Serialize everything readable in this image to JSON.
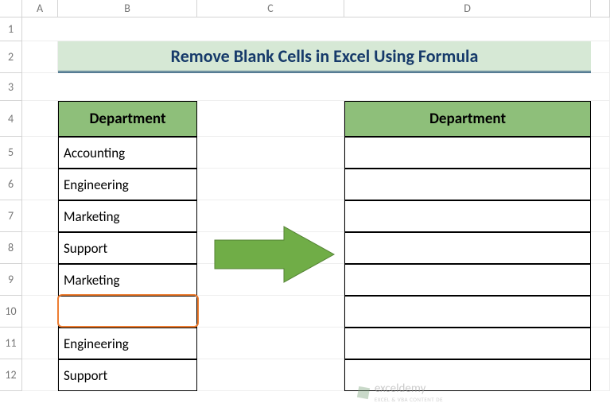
{
  "columns": [
    "A",
    "B",
    "C",
    "D"
  ],
  "rows": [
    "1",
    "2",
    "3",
    "4",
    "5",
    "6",
    "7",
    "8",
    "9",
    "10",
    "11",
    "12"
  ],
  "title": "Remove Blank Cells in Excel Using Formula",
  "table1": {
    "header": "Department",
    "cells": [
      "Accounting",
      "Engineering",
      "Marketing",
      "Support",
      "Marketing",
      "",
      "Engineering",
      "Support"
    ]
  },
  "table2": {
    "header": "Department",
    "cells": [
      "",
      "",
      "",
      "",
      "",
      "",
      "",
      ""
    ]
  },
  "watermark": {
    "brand": "exceldemy",
    "tagline": "EXCEL & VBA CONTENT DE"
  },
  "chart_data": null
}
